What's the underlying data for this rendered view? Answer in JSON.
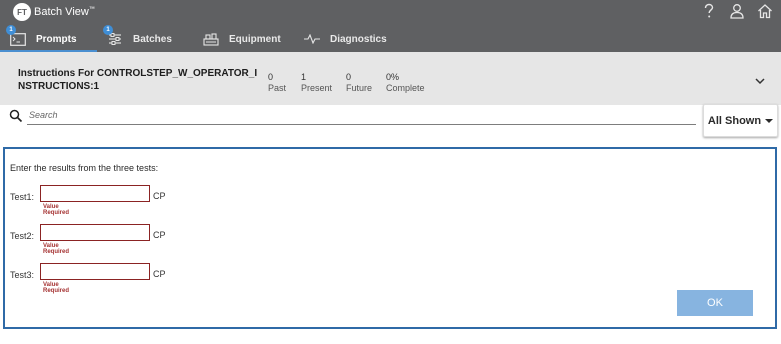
{
  "app": {
    "logo_mark": "FT",
    "title": "Batch View",
    "trademark": "™"
  },
  "header_icons": [
    {
      "name": "help-icon"
    },
    {
      "name": "user-icon"
    },
    {
      "name": "home-icon"
    }
  ],
  "tabs": [
    {
      "label": "Prompts",
      "badge": "1",
      "icon": "prompts-icon",
      "active": true
    },
    {
      "label": "Batches",
      "badge": "1",
      "icon": "batches-icon",
      "active": false
    },
    {
      "label": "Equipment",
      "badge": "",
      "icon": "equipment-icon",
      "active": false
    },
    {
      "label": "Diagnostics",
      "badge": "",
      "icon": "diagnostics-icon",
      "active": false
    }
  ],
  "instruction": {
    "title": "Instructions For CONTROLSTEP_W_OPERATOR_INSTRUCTIONS:1",
    "stats": [
      {
        "value": "0",
        "label": "Past"
      },
      {
        "value": "1",
        "label": "Present"
      },
      {
        "value": "0",
        "label": "Future"
      },
      {
        "value": "0%",
        "label": "Complete"
      }
    ]
  },
  "search": {
    "placeholder": "Search",
    "value": ""
  },
  "filter": {
    "label": "All Shown"
  },
  "form": {
    "prompt": "Enter the results from the three tests:",
    "fields": [
      {
        "label": "Test1:",
        "value": "",
        "unit": "CP",
        "error": "Value Required"
      },
      {
        "label": "Test2:",
        "value": "",
        "unit": "CP",
        "error": "Value Required"
      },
      {
        "label": "Test3:",
        "value": "",
        "unit": "CP",
        "error": "Value Required"
      }
    ],
    "ok_label": "OK"
  },
  "colors": {
    "topbar": "#5f6062",
    "header_bg": "#e6e6e6",
    "panel_border": "#2f6aa7",
    "tab_underline": "#4a8fd0",
    "badge": "#3f8ed6",
    "error": "#a53232",
    "field_border": "#8b2323",
    "ok_button": "#87b4e0"
  }
}
